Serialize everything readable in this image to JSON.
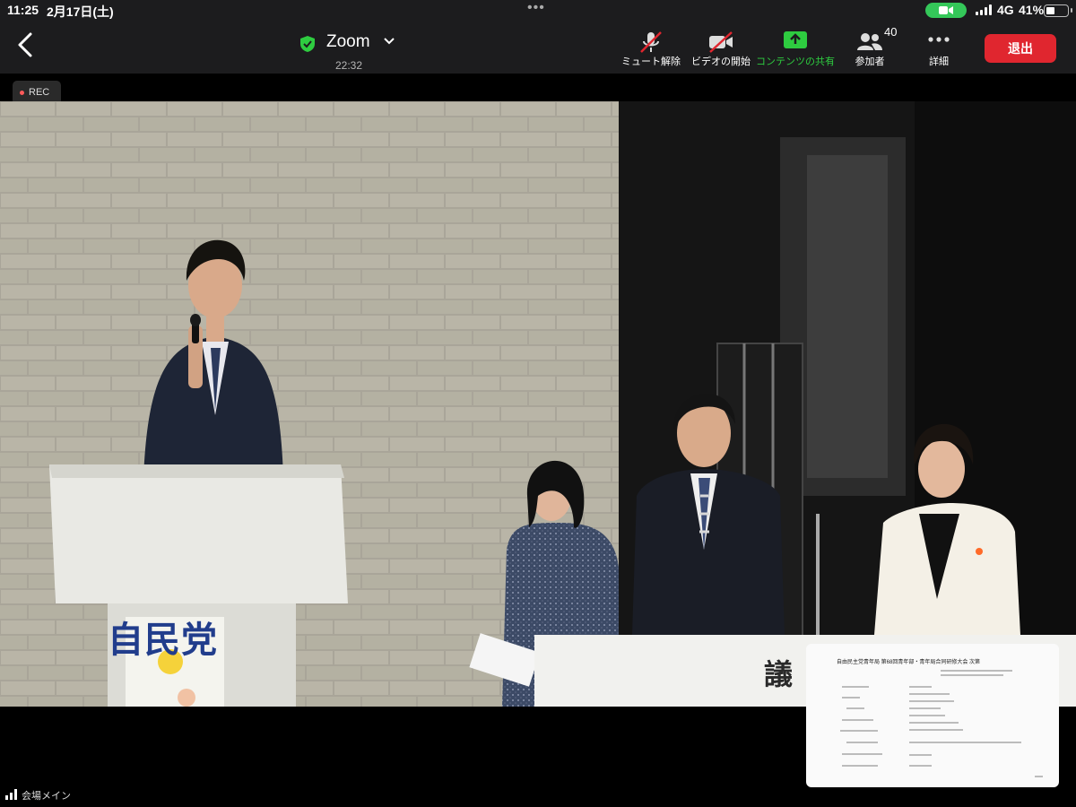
{
  "status_bar": {
    "time": "11:25",
    "date": "2月17日(土)",
    "network": "4G",
    "battery": "41%",
    "battery_level": 0.41
  },
  "toolbar": {
    "title": "Zoom",
    "meeting_time": "22:32",
    "unmute_label": "ミュート解除",
    "video_label": "ビデオの開始",
    "share_label": "コンテンツの共有",
    "participants_label": "参加者",
    "participants_count": "40",
    "more_label": "詳細",
    "leave_label": "退出",
    "accent_share": "#2ecc40",
    "leave_color": "#e0262f"
  },
  "video": {
    "rec_label": "REC",
    "podium_text": "自民党",
    "room_label": "会場メイン"
  },
  "shared_content": {
    "doc_title": "自由民主党青年局 第68回青年部・青年局合同研修大会 次第"
  }
}
